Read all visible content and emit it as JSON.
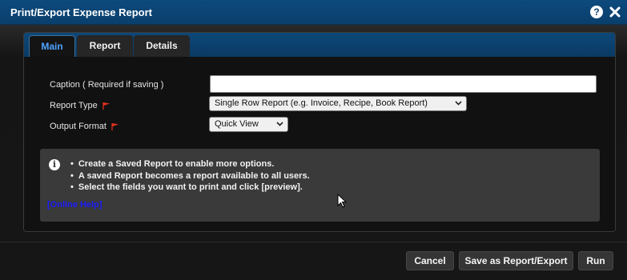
{
  "window": {
    "title": "Print/Export Expense Report",
    "help_label": "?"
  },
  "tabs": [
    {
      "label": "Main",
      "active": true
    },
    {
      "label": "Report",
      "active": false
    },
    {
      "label": "Details",
      "active": false
    }
  ],
  "form": {
    "caption_label": "Caption ( Required if saving )",
    "caption_value": "",
    "report_type_label": "Report Type",
    "report_type_value": "Single Row Report (e.g. Invoice, Recipe, Book Report)",
    "output_format_label": "Output Format",
    "output_format_value": "Quick View"
  },
  "info": {
    "icon_glyph": "i",
    "items": [
      "Create a Saved Report to enable more options.",
      "A saved Report becomes a report available to all users.",
      "Select the fields you want to print and click [preview]."
    ],
    "help_link": "[Online Help]"
  },
  "buttons": {
    "cancel": "Cancel",
    "save": "Save as Report/Export",
    "run": "Run"
  },
  "colors": {
    "titlebar": "#0b4274",
    "active_tab_text": "#4ea3ff",
    "flag": "#e0301e",
    "link": "#1a1aff"
  }
}
